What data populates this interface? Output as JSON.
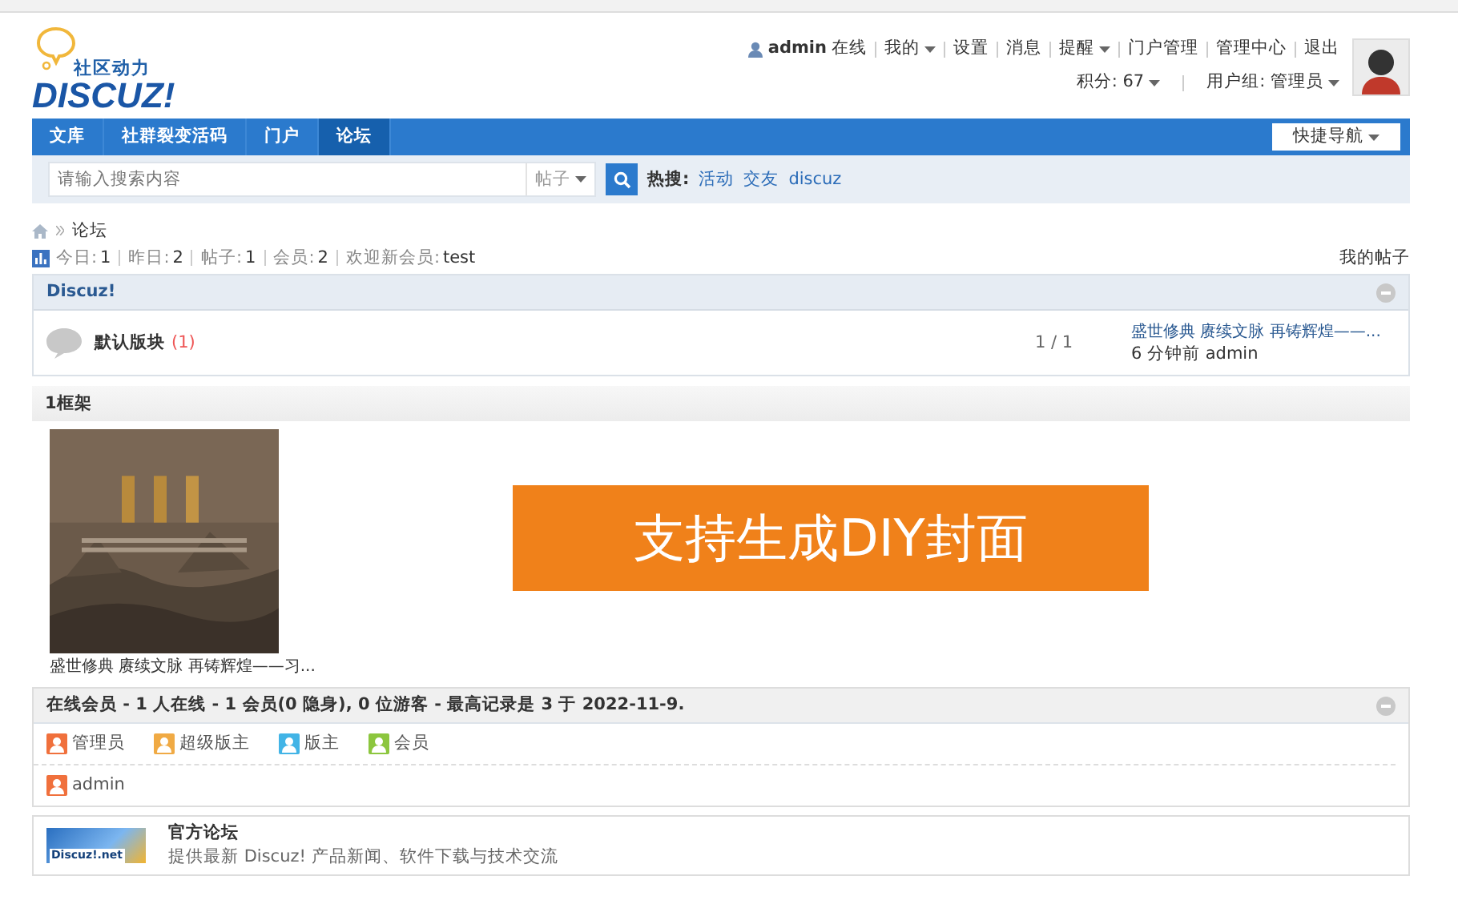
{
  "header": {
    "logo": {
      "tagline": "社区动力",
      "wordmark": "DISCUZ!"
    },
    "user_bar": {
      "username": "admin",
      "status": "在线",
      "links": [
        {
          "label": "我的",
          "dropdown": true
        },
        {
          "label": "设置",
          "dropdown": false
        },
        {
          "label": "消息",
          "dropdown": false
        },
        {
          "label": "提醒",
          "dropdown": true
        },
        {
          "label": "门户管理",
          "dropdown": false
        },
        {
          "label": "管理中心",
          "dropdown": false
        },
        {
          "label": "退出",
          "dropdown": false
        }
      ],
      "credits": "积分: 67",
      "group": "用户组: 管理员"
    }
  },
  "nav": {
    "items": [
      {
        "label": "文库",
        "selected": false
      },
      {
        "label": "社群裂变活码",
        "selected": false
      },
      {
        "label": "门户",
        "selected": false
      },
      {
        "label": "论坛",
        "selected": true
      }
    ],
    "quick_nav": "快捷导航"
  },
  "search": {
    "placeholder": "请输入搜索内容",
    "type": "帖子",
    "hot_label": "热搜:",
    "hot": [
      "活动",
      "交友",
      "discuz"
    ]
  },
  "breadcrumb": [
    "论坛"
  ],
  "stats": {
    "items": [
      {
        "label": "今日:",
        "value": "1"
      },
      {
        "label": "昨日:",
        "value": "2"
      },
      {
        "label": "帖子:",
        "value": "1"
      },
      {
        "label": "会员:",
        "value": "2"
      },
      {
        "label": "欢迎新会员:",
        "value": "test"
      }
    ],
    "my_posts": "我的帖子"
  },
  "category": {
    "title": "Discuz!",
    "forums": [
      {
        "name": "默认版块",
        "count": "(1)",
        "stats": "1 / 1",
        "last_post_title": "盛世修典 赓续文脉 再铸辉煌——...",
        "last_post_meta": "6 分钟前 admin"
      }
    ]
  },
  "diy_frame": {
    "title": "1框架",
    "items": [
      {
        "kind": "picture",
        "caption": "盛世修典 赓续文脉 再铸辉煌——习..."
      }
    ]
  },
  "overlay_banner": "支持生成DIY封面",
  "online": {
    "summary": "在线会员 - 1 人在线 - 1 会员(0 隐身), 0 位游客 - 最高记录是 3 于 2022-11-9.",
    "legend": [
      {
        "label": "管理员",
        "color": "#f0703c"
      },
      {
        "label": "超级版主",
        "color": "#f0aa44"
      },
      {
        "label": "版主",
        "color": "#42b4e6"
      },
      {
        "label": "会员",
        "color": "#8cc63e"
      }
    ],
    "members": [
      {
        "name": "admin",
        "color": "#f0703c"
      }
    ]
  },
  "links": [
    {
      "logo_text": "Discuz!.net",
      "title": "官方论坛",
      "description": "提供最新 Discuz! 产品新闻、软件下载与技术交流"
    }
  ]
}
